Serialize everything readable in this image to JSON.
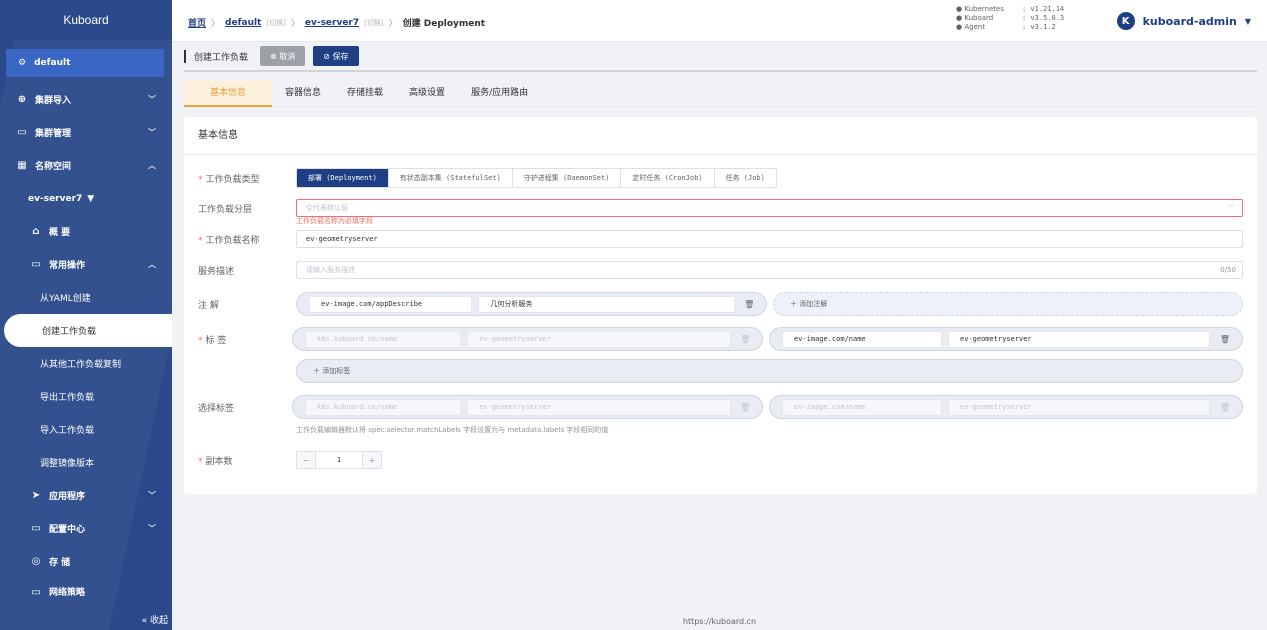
{
  "sidebar": {
    "logo": "Kuboard",
    "namespace": "default",
    "items": [
      {
        "label": "集群导入",
        "icon": "⊕"
      },
      {
        "label": "集群管理",
        "icon": "▭"
      },
      {
        "label": "名称空间",
        "icon": "▦"
      }
    ],
    "cluster": "ev-server7",
    "overview": "概 要",
    "common_ops": "常用操作",
    "sub_items": [
      "从YAML创建",
      "创建工作负载",
      "从其他工作负载复制",
      "导出工作负载",
      "导入工作负载",
      "调整镜像版本"
    ],
    "bottom_items": [
      {
        "label": "应用程序",
        "icon": "➤"
      },
      {
        "label": "配置中心",
        "icon": "▭"
      },
      {
        "label": "存 储",
        "icon": "◎"
      },
      {
        "label": "网络策略",
        "icon": "▭"
      }
    ],
    "collapse": "« 收起"
  },
  "header": {
    "breadcrumb": {
      "home": "首页",
      "ns": "default",
      "switch": "[切换]",
      "cluster": "ev-server7",
      "current": "创建 Deployment"
    },
    "versions": [
      {
        "k": "Kubernetes",
        "v": ": v1.21.14"
      },
      {
        "k": "Kuboard",
        "v": ": v3.5.0.3"
      },
      {
        "k": "Agent",
        "v": ": v3.1.2"
      }
    ],
    "user": "kuboard-admin",
    "avatar_letter": "K"
  },
  "toolbar": {
    "title": "创建工作负载",
    "cancel": "⊗ 取消",
    "save": "⊘ 保存"
  },
  "tabs": [
    "基本信息",
    "容器信息",
    "存储挂载",
    "高级设置",
    "服务/应用路由"
  ],
  "card": {
    "title": "基本信息",
    "workload_type_label": "工作负载类型",
    "workload_types": [
      "部署 (Deployment)",
      "有状态副本集 (StatefulSet)",
      "守护进程集 (DaemonSet)",
      "定时任务 (CronJob)",
      "任务 (Job)"
    ],
    "layer_label": "工作负载分层",
    "layer_placeholder": "空代表默认层",
    "layer_error": "工作负载名称为必填字段",
    "name_label": "工作负载名称",
    "name_value": "ev-geometryserver",
    "desc_label": "服务描述",
    "desc_placeholder": "请输入服务描述",
    "desc_count": "0/50",
    "annotation_label": "注 解",
    "annotation_key": "ev-image.com/appDescribe",
    "annotation_value": "几何分析服务",
    "add_annotation": "＋ 添加注解",
    "labels_label": "标 签",
    "labels": [
      {
        "key": "k8s.kuboard.cn/name",
        "value": "ev-geometryserver"
      },
      {
        "key": "ev-image.com/name",
        "value": "ev-geometryserver"
      }
    ],
    "add_label": "＋ 添加标签",
    "selector_label": "选择标签",
    "selectors": [
      {
        "key": "k8s.kuboard.cn/name",
        "value": "ev-geometryserver"
      },
      {
        "key": "ev-image.com/name",
        "value": "ev-geometryserver"
      }
    ],
    "selector_hint": "工作负载编辑器默认将 spec.selector.matchLabels 字段设置为与 metadata.labels 字段相同的值",
    "replicas_label": "副本数",
    "replicas": "1",
    "minus": "−",
    "plus": "+"
  },
  "footer": "https://kuboard.cn"
}
